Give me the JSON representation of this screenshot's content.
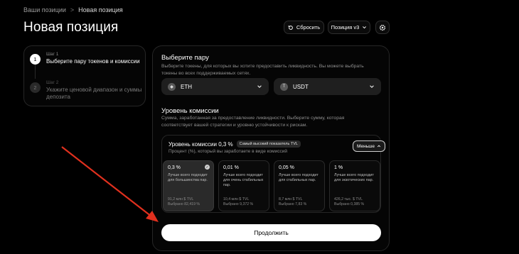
{
  "breadcrumb": {
    "parent": "Ваши позиции",
    "separator": ">",
    "current": "Новая позиция"
  },
  "page_title": "Новая позиция",
  "header_buttons": {
    "reset": "Сбросить",
    "version": "Позиция v3"
  },
  "steps": [
    {
      "tag": "Шаг 1",
      "num": "1",
      "text": "Выберите пару токенов и комиссии"
    },
    {
      "tag": "Шаг 2",
      "num": "2",
      "text": "Укажите ценовой диапазон и суммы депозита"
    }
  ],
  "pair": {
    "title": "Выберите пару",
    "desc": "Выберите токены, для которых вы хотите предоставить ликвидность. Вы можете выбрать токены во всех поддерживаемых сетях.",
    "token_a": "ETH",
    "token_b": "USDT"
  },
  "fee": {
    "title": "Уровень комиссии",
    "desc": "Сумма, заработанная за предоставление ликвидности. Выберите сумму, которая соответствует вашей стратегии и уровню устойчивости к рискам.",
    "selected_label": "Уровень комиссии 0,3 %",
    "badge": "Самый высокий показатель TVL",
    "sub": "Процент (%), который вы заработаете в виде комиссий",
    "less_button": "Меньше",
    "tiers": [
      {
        "pct": "0,3 %",
        "desc": "Лучше всего подходит для большинства пар.",
        "tvl": "91,2 млн $ TVL",
        "chosen": "Выбрано 82,419 %"
      },
      {
        "pct": "0,01 %",
        "desc": "Лучше всего подходит для очень стабильных пар.",
        "tvl": "10,4 млн $ TVL",
        "chosen": "Выбрано 9,372 %"
      },
      {
        "pct": "0,05 %",
        "desc": "Лучше всего подходит для стабильных пар.",
        "tvl": "8,7 млн $ TVL",
        "chosen": "Выбрано 7,83 %"
      },
      {
        "pct": "1 %",
        "desc": "Лучше всего подходит для экзотических пар.",
        "tvl": "426,2 тыс. $ TVL",
        "chosen": "Выбрано 0,385 %"
      }
    ]
  },
  "continue_button": "Продолжить",
  "colors": {
    "background": "#000000",
    "annotation_arrow": "#e0301e"
  }
}
